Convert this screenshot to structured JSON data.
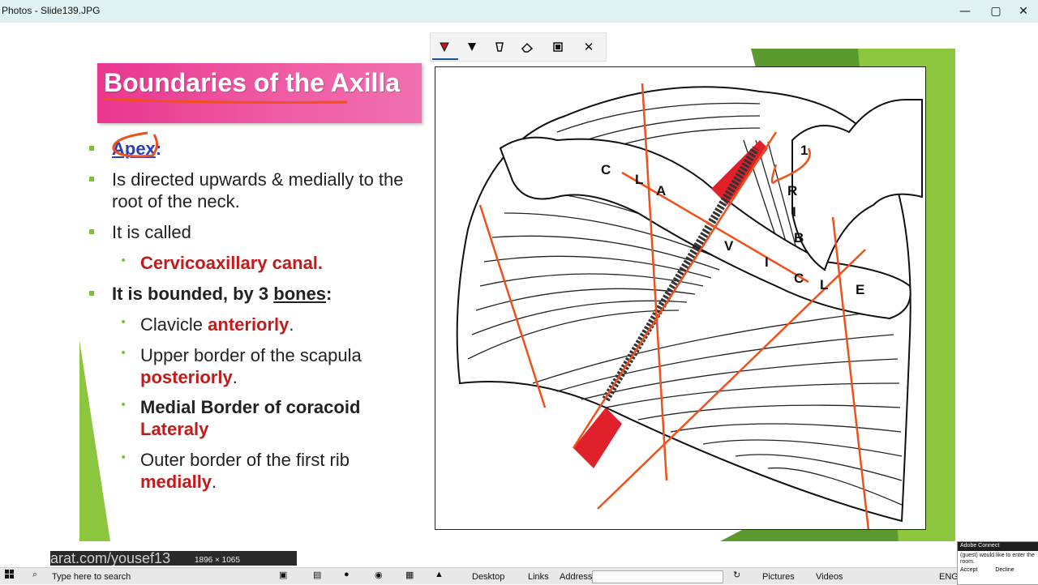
{
  "window": {
    "title": "Photos - Slide139.JPG",
    "minimize": "—",
    "maximize": "▢",
    "close": "✕"
  },
  "ink_toolbar": {
    "tools": [
      "ballpoint-pen",
      "pencil",
      "highlighter",
      "eraser",
      "calligraphy",
      "close"
    ],
    "close_label": "✕"
  },
  "slide": {
    "title": "Boundaries of the Axilla",
    "bullets": {
      "apex": "Apex",
      "apex_colon": ":",
      "directed": "Is directed upwards & medially to the root of the neck.",
      "called": "It is called",
      "canal": "Cervicoaxillary canal.",
      "bounded_prefix": "It is bounded, by 3 ",
      "bounded_bones": "bones",
      "bounded_suffix": ":",
      "clavicle": "Clavicle ",
      "anteriorly": "anteriorly",
      "dot": ".",
      "upper_border": "Upper border of the scapula",
      "posteriorly": "posteriorly",
      "medial_border": "Medial Border of coracoid",
      "lateraly": "Lateraly",
      "outer_border": "Outer border of the first rib",
      "medially": "medially"
    },
    "figure_labels": {
      "c1": "C",
      "l1": "L",
      "a": "A",
      "v": "V",
      "i1": "I",
      "c2": "C",
      "l2": "L",
      "e": "E",
      "r": "R",
      "i2": "I",
      "b": "B",
      "one": "1"
    },
    "colors": {
      "title_bg": "#e9368f",
      "accent_green": "#7cbf36",
      "red_text": "#c21b1b",
      "blue_text": "#2c3fb8",
      "ink_orange": "#f0501a"
    }
  },
  "taskbar": {
    "search_placeholder": "Type here to search",
    "desktop": "Desktop",
    "links": "Links",
    "address": "Address",
    "pictures": "Pictures",
    "videos": "Videos",
    "lang": "ENG",
    "overlay_text": "arat.com/yousef13",
    "overlay_dim": "1896 × 1065"
  },
  "adobe_connect": {
    "header": "Adobe Connect",
    "message": "(guest) would like to enter the room.",
    "accept": "Accept",
    "decline": "Decline"
  }
}
